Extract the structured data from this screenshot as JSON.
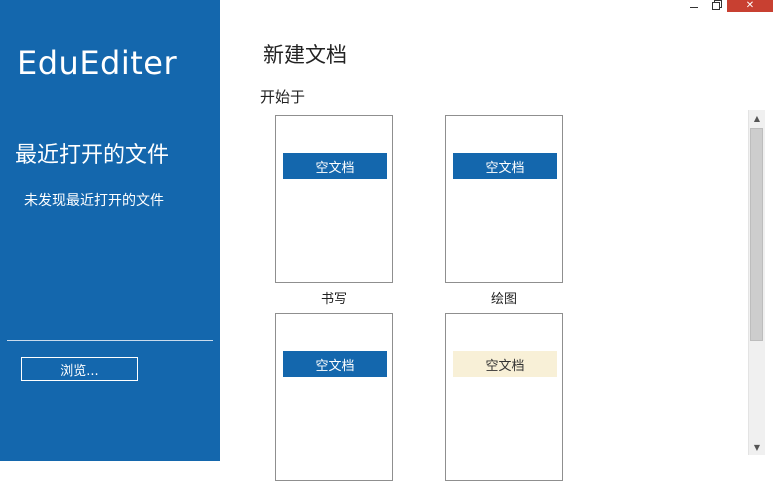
{
  "window": {
    "minimize_icon": "minimize-icon",
    "maximize_icon": "restore-icon",
    "close_icon": "close-icon"
  },
  "sidebar": {
    "app_title": "EduEditer",
    "recent_heading": "最近打开的文件",
    "recent_empty": "未发现最近打开的文件",
    "browse_label": "浏览...",
    "background": "#1467ad"
  },
  "main": {
    "title": "新建文档",
    "section_label": "开始于",
    "templates": [
      {
        "tag": "空文档",
        "caption": "书写"
      },
      {
        "tag": "空文档",
        "caption": "绘图"
      },
      {
        "tag": "空文档",
        "caption": ""
      },
      {
        "tag": "空文档",
        "caption": ""
      }
    ]
  },
  "colors": {
    "accent": "#1467ad",
    "highlight_tag": "#f8f0d7",
    "close_button": "#c84031"
  }
}
